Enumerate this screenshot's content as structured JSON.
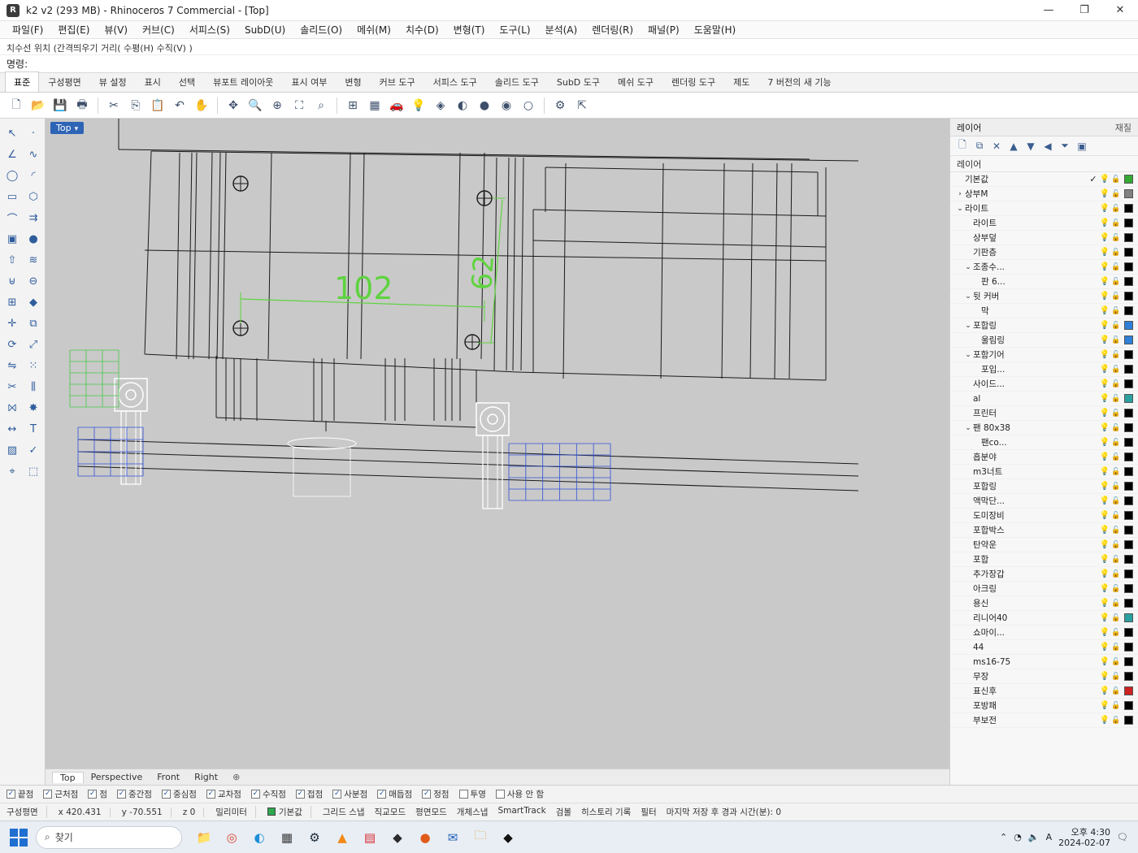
{
  "window": {
    "title": "k2 v2 (293 MB) - Rhinoceros 7 Commercial - [Top]",
    "icon": "rhino-icon",
    "controls": [
      "minimize",
      "maximize",
      "close"
    ]
  },
  "menubar": {
    "items": [
      "파일(F)",
      "편집(E)",
      "뷰(V)",
      "커브(C)",
      "서피스(S)",
      "SubD(U)",
      "솔리드(O)",
      "메쉬(M)",
      "치수(D)",
      "변형(T)",
      "도구(L)",
      "분석(A)",
      "렌더링(R)",
      "패널(P)",
      "도움말(H)"
    ]
  },
  "command": {
    "history": "치수선 위치 (간격띄우기 거리( 수평(H) 수직(V) )",
    "prompt_label": "명령:",
    "input_value": ""
  },
  "ribbon": {
    "tabs": [
      "표준",
      "구성평면",
      "뷰 설정",
      "표시",
      "선택",
      "뷰포트 레이아웃",
      "표시 여부",
      "변형",
      "커브 도구",
      "서피스 도구",
      "솔리드 도구",
      "SubD 도구",
      "메쉬 도구",
      "렌더링 도구",
      "제도",
      "7 버전의 새 기능"
    ],
    "active_tab": 0
  },
  "toolbar": {
    "buttons": [
      {
        "name": "new-icon",
        "glyph": "🗋"
      },
      {
        "name": "open-icon",
        "glyph": "📂"
      },
      {
        "name": "save-icon",
        "glyph": "💾"
      },
      {
        "name": "print-icon",
        "glyph": "🖶"
      },
      {
        "name": "sep"
      },
      {
        "name": "cut-icon",
        "glyph": "✂"
      },
      {
        "name": "copy-icon",
        "glyph": "⎘"
      },
      {
        "name": "paste-icon",
        "glyph": "📋"
      },
      {
        "name": "undo-icon",
        "glyph": "↶"
      },
      {
        "name": "pan-icon",
        "glyph": "✋"
      },
      {
        "name": "sep"
      },
      {
        "name": "rotate-view-icon",
        "glyph": "✥"
      },
      {
        "name": "zoom-icon",
        "glyph": "🔍"
      },
      {
        "name": "zoom-window-icon",
        "glyph": "⊕"
      },
      {
        "name": "zoom-extents-icon",
        "glyph": "⛶"
      },
      {
        "name": "zoom-selected-icon",
        "glyph": "⌕"
      },
      {
        "name": "sep"
      },
      {
        "name": "viewport-layout-icon",
        "glyph": "⊞"
      },
      {
        "name": "cplane-icon",
        "glyph": "▦"
      },
      {
        "name": "car-icon",
        "glyph": "🚗"
      },
      {
        "name": "lightbulb-icon",
        "glyph": "💡"
      },
      {
        "name": "material-icon",
        "glyph": "◈"
      },
      {
        "name": "render-icon",
        "glyph": "◐"
      },
      {
        "name": "shade-icon",
        "glyph": "●"
      },
      {
        "name": "rendered-sphere-icon",
        "glyph": "◉"
      },
      {
        "name": "wireframe-sphere-icon",
        "glyph": "○"
      },
      {
        "name": "sep"
      },
      {
        "name": "options-icon",
        "glyph": "⚙"
      },
      {
        "name": "select-icon",
        "glyph": "⇱"
      }
    ]
  },
  "lefttools": [
    {
      "name": "arrow-select-icon",
      "glyph": "↖"
    },
    {
      "name": "point-icon",
      "glyph": "·"
    },
    {
      "name": "polyline-icon",
      "glyph": "∠"
    },
    {
      "name": "curve-icon",
      "glyph": "∿"
    },
    {
      "name": "circle-icon",
      "glyph": "◯"
    },
    {
      "name": "arc-icon",
      "glyph": "◜"
    },
    {
      "name": "rectangle-icon",
      "glyph": "▭"
    },
    {
      "name": "polygon-icon",
      "glyph": "⬡"
    },
    {
      "name": "fillet-icon",
      "glyph": "⌒"
    },
    {
      "name": "offset-icon",
      "glyph": "⇉"
    },
    {
      "name": "box-icon",
      "glyph": "▣"
    },
    {
      "name": "sphere-icon",
      "glyph": "●"
    },
    {
      "name": "extrude-icon",
      "glyph": "⇧"
    },
    {
      "name": "loft-icon",
      "glyph": "≋"
    },
    {
      "name": "boolean-union-icon",
      "glyph": "⊎"
    },
    {
      "name": "boolean-diff-icon",
      "glyph": "⊖"
    },
    {
      "name": "mesh-icon",
      "glyph": "⊞"
    },
    {
      "name": "subd-icon",
      "glyph": "◆"
    },
    {
      "name": "move-icon",
      "glyph": "✛"
    },
    {
      "name": "copy-obj-icon",
      "glyph": "⧉"
    },
    {
      "name": "rotate-icon",
      "glyph": "⟳"
    },
    {
      "name": "scale-icon",
      "glyph": "⤢"
    },
    {
      "name": "mirror-icon",
      "glyph": "⇋"
    },
    {
      "name": "array-icon",
      "glyph": "⁙"
    },
    {
      "name": "trim-icon",
      "glyph": "✂"
    },
    {
      "name": "split-icon",
      "glyph": "⫼"
    },
    {
      "name": "join-icon",
      "glyph": "⨝"
    },
    {
      "name": "explode-icon",
      "glyph": "✸"
    },
    {
      "name": "dimension-icon",
      "glyph": "↔"
    },
    {
      "name": "text-icon",
      "glyph": "T"
    },
    {
      "name": "hatch-icon",
      "glyph": "▨"
    },
    {
      "name": "check-icon",
      "glyph": "✓"
    },
    {
      "name": "analyze-icon",
      "glyph": "⌖"
    },
    {
      "name": "group-icon",
      "glyph": "⬚"
    }
  ],
  "viewport": {
    "label": "Top",
    "dimensions": [
      {
        "text": "102",
        "value": 102
      },
      {
        "text": "62",
        "value": 62
      }
    ],
    "tabs": [
      "Top",
      "Perspective",
      "Front",
      "Right"
    ],
    "add_tab": "⊕",
    "colors": {
      "background": "#c9c9c9",
      "lines": "#1a1a1a",
      "dimension": "#5fd33f",
      "white_parts": "#ffffff",
      "blue_parts": "#2f4fd8",
      "green_parts": "#45c845"
    }
  },
  "layers_panel": {
    "title": "레이어",
    "right_tab": "재질",
    "column_header": "레이어",
    "rows": [
      {
        "name": "기본값",
        "level": 0,
        "expander": "",
        "current": "✓",
        "color": "#33aa33"
      },
      {
        "name": "상부M",
        "level": 0,
        "expander": "›",
        "current": "",
        "color": "#808080"
      },
      {
        "name": "라이트",
        "level": 0,
        "expander": "⌄",
        "current": "",
        "color": "#000000"
      },
      {
        "name": "라이트",
        "level": 1,
        "expander": "",
        "current": "",
        "color": "#000000"
      },
      {
        "name": "상부덮",
        "level": 1,
        "expander": "",
        "current": "",
        "color": "#000000"
      },
      {
        "name": "기판층",
        "level": 1,
        "expander": "",
        "current": "",
        "color": "#000000"
      },
      {
        "name": "조종수...",
        "level": 1,
        "expander": "⌄",
        "current": "",
        "color": "#000000"
      },
      {
        "name": "판 6...",
        "level": 2,
        "expander": "",
        "current": "",
        "color": "#000000"
      },
      {
        "name": "뒷 커버",
        "level": 1,
        "expander": "⌄",
        "current": "",
        "color": "#000000"
      },
      {
        "name": "막",
        "level": 2,
        "expander": "",
        "current": "",
        "color": "#000000"
      },
      {
        "name": "포합링",
        "level": 1,
        "expander": "⌄",
        "current": "",
        "color": "#2d7fd8"
      },
      {
        "name": "울림링",
        "level": 2,
        "expander": "",
        "current": "",
        "color": "#2d7fd8"
      },
      {
        "name": "포함기어",
        "level": 1,
        "expander": "⌄",
        "current": "",
        "color": "#000000"
      },
      {
        "name": "포입...",
        "level": 2,
        "expander": "",
        "current": "",
        "color": "#000000"
      },
      {
        "name": "사이드...",
        "level": 1,
        "expander": "",
        "current": "",
        "color": "#000000"
      },
      {
        "name": "al",
        "level": 1,
        "expander": "",
        "current": "",
        "color": "#2aa0a0"
      },
      {
        "name": "프린터",
        "level": 1,
        "expander": "",
        "current": "",
        "color": "#000000"
      },
      {
        "name": "팬 80x38",
        "level": 1,
        "expander": "⌄",
        "current": "",
        "color": "#000000"
      },
      {
        "name": "팬co...",
        "level": 2,
        "expander": "",
        "current": "",
        "color": "#000000"
      },
      {
        "name": "흡분야",
        "level": 1,
        "expander": "",
        "current": "",
        "color": "#000000"
      },
      {
        "name": "m3너트",
        "level": 1,
        "expander": "",
        "current": "",
        "color": "#000000"
      },
      {
        "name": "포합링",
        "level": 1,
        "expander": "",
        "current": "",
        "color": "#000000"
      },
      {
        "name": "액막단...",
        "level": 1,
        "expander": "",
        "current": "",
        "color": "#000000"
      },
      {
        "name": "도미장비",
        "level": 1,
        "expander": "",
        "current": "",
        "color": "#000000"
      },
      {
        "name": "포합박스",
        "level": 1,
        "expander": "",
        "current": "",
        "color": "#000000"
      },
      {
        "name": "탄약운",
        "level": 1,
        "expander": "",
        "current": "",
        "color": "#000000"
      },
      {
        "name": "포합",
        "level": 1,
        "expander": "",
        "current": "",
        "color": "#000000"
      },
      {
        "name": "추가장갑",
        "level": 1,
        "expander": "",
        "current": "",
        "color": "#000000"
      },
      {
        "name": "아크링",
        "level": 1,
        "expander": "",
        "current": "",
        "color": "#000000"
      },
      {
        "name": "용신",
        "level": 1,
        "expander": "",
        "current": "",
        "color": "#000000"
      },
      {
        "name": "리니어40",
        "level": 1,
        "expander": "",
        "current": "",
        "color": "#2aa0a0"
      },
      {
        "name": "쇼마이...",
        "level": 1,
        "expander": "",
        "current": "",
        "color": "#000000"
      },
      {
        "name": "44",
        "level": 1,
        "expander": "",
        "current": "",
        "color": "#000000"
      },
      {
        "name": "ms16-75",
        "level": 1,
        "expander": "",
        "current": "",
        "color": "#000000"
      },
      {
        "name": "무장",
        "level": 1,
        "expander": "",
        "current": "",
        "color": "#000000"
      },
      {
        "name": "표신후",
        "level": 1,
        "expander": "",
        "current": "",
        "color": "#cc2222"
      },
      {
        "name": "포방패",
        "level": 1,
        "expander": "",
        "current": "",
        "color": "#000000"
      },
      {
        "name": "부보전",
        "level": 1,
        "expander": "",
        "current": "",
        "color": "#000000"
      }
    ]
  },
  "snaps": [
    {
      "label": "끝점",
      "checked": true
    },
    {
      "label": "근처점",
      "checked": true
    },
    {
      "label": "점",
      "checked": true
    },
    {
      "label": "중간점",
      "checked": true
    },
    {
      "label": "중심점",
      "checked": true
    },
    {
      "label": "교차점",
      "checked": true
    },
    {
      "label": "수직점",
      "checked": true
    },
    {
      "label": "접점",
      "checked": true
    },
    {
      "label": "사분점",
      "checked": true
    },
    {
      "label": "매듭점",
      "checked": true
    },
    {
      "label": "정점",
      "checked": true
    },
    {
      "label": "투영",
      "checked": false
    },
    {
      "label": "사용 안 함",
      "checked": false
    }
  ],
  "infobar": {
    "cplane": "구성평면",
    "x": "x 420.431",
    "y": "y -70.551",
    "z": "z 0",
    "units": "밀리미터",
    "layer_name": "기본값",
    "layer_color": "#2fa84f",
    "toggles": [
      "그리드 스냅",
      "직교모드",
      "평면모드",
      "개체스냅",
      "SmartTrack",
      "검볼",
      "히스토리 기록",
      "필터",
      "마지막 저장 후 경과 시간(분): 0"
    ]
  },
  "taskbar": {
    "search_placeholder": "찾기",
    "apps": [
      {
        "name": "file-explorer-icon",
        "glyph": "📁",
        "color": "#e8b43a"
      },
      {
        "name": "chrome-icon",
        "glyph": "◎",
        "color": "#d8452e"
      },
      {
        "name": "edge-icon",
        "glyph": "◐",
        "color": "#1f8fd8"
      },
      {
        "name": "calculator-icon",
        "glyph": "▦",
        "color": "#3a3a3a"
      },
      {
        "name": "steam-icon",
        "glyph": "⚙",
        "color": "#1b2838"
      },
      {
        "name": "vlc-icon",
        "glyph": "▲",
        "color": "#f08a18"
      },
      {
        "name": "pdf-icon",
        "glyph": "▤",
        "color": "#d8262e"
      },
      {
        "name": "rhino-taskbar-icon",
        "glyph": "◆",
        "color": "#2b2b2b"
      },
      {
        "name": "browser-icon",
        "glyph": "●",
        "color": "#e05a1a"
      },
      {
        "name": "outlook-icon",
        "glyph": "✉",
        "color": "#1e5fb8"
      },
      {
        "name": "folder-icon",
        "glyph": "🗀",
        "color": "#d8a83a"
      },
      {
        "name": "rhino-active-icon",
        "glyph": "◆",
        "color": "#111111"
      }
    ],
    "tray": {
      "lang": "A",
      "time": "오후 4:30",
      "date": "2024-02-07"
    }
  }
}
